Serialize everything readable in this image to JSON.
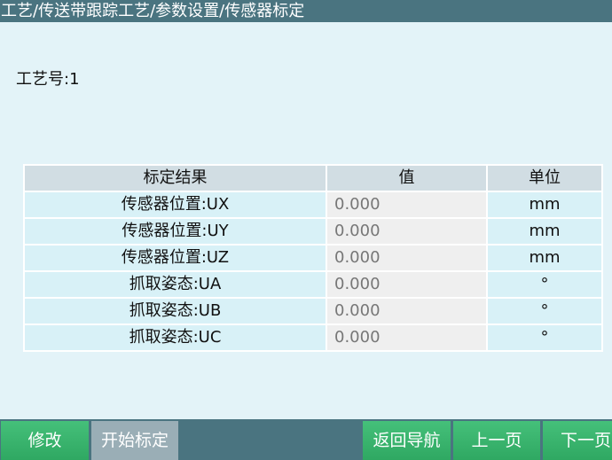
{
  "header": {
    "breadcrumb": "工艺/传送带跟踪工艺/参数设置/传感器标定"
  },
  "main": {
    "process_no": "工艺号:1"
  },
  "table": {
    "headers": [
      "标定结果",
      "值",
      "单位"
    ],
    "rows": [
      {
        "name": "传感器位置:UX",
        "value": "0.000",
        "unit": "mm"
      },
      {
        "name": "传感器位置:UY",
        "value": "0.000",
        "unit": "mm"
      },
      {
        "name": "传感器位置:UZ",
        "value": "0.000",
        "unit": "mm"
      },
      {
        "name": "抓取姿态:UA",
        "value": "0.000",
        "unit": "°"
      },
      {
        "name": "抓取姿态:UB",
        "value": "0.000",
        "unit": "°"
      },
      {
        "name": "抓取姿态:UC",
        "value": "0.000",
        "unit": "°"
      }
    ]
  },
  "toolbar": {
    "modify": "修改",
    "start_calibration": "开始标定",
    "back_nav": "返回导航",
    "prev_page": "上一页",
    "next_page": "下一页"
  },
  "colors": {
    "header_bg": "#4a7480",
    "page_bg": "#e3f3f8",
    "button_green": "#3bb46f",
    "button_disabled": "#9aaeb6"
  }
}
